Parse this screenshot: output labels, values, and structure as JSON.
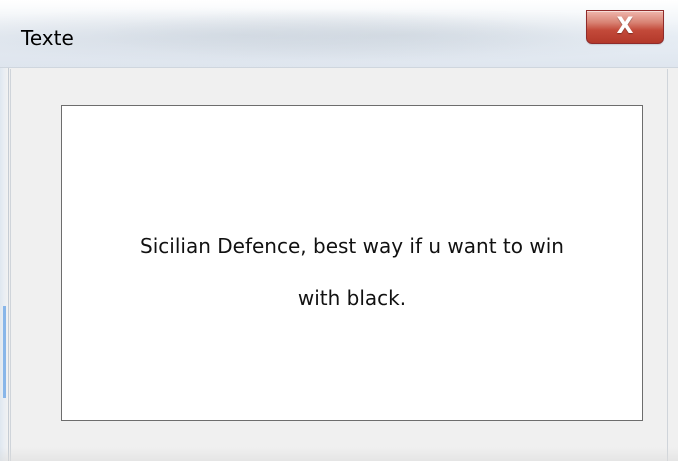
{
  "window": {
    "title": "Texte",
    "close_glyph": "X"
  },
  "message": {
    "line_1": "Sicilian Defence, best way if u want to win",
    "line_2": "with black."
  },
  "icons": {
    "close": "close-icon"
  },
  "colors": {
    "window_background": "#f0f0f0",
    "panel_background": "#ffffff",
    "panel_border": "#6d6d6d",
    "close_button": "#c34a3a",
    "text": "#111111"
  }
}
